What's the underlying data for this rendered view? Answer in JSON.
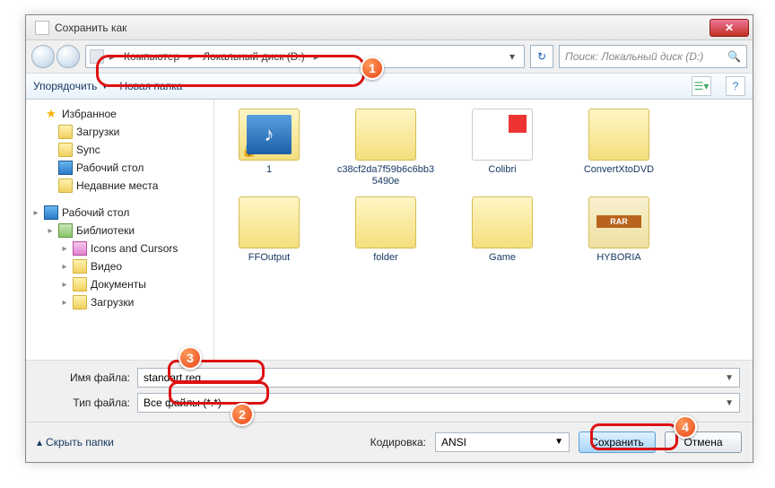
{
  "window": {
    "title": "Сохранить как"
  },
  "breadcrumb": {
    "seg1": "Компьютер",
    "seg2": "Локальный диск (D:)"
  },
  "search": {
    "placeholder": "Поиск: Локальный диск (D:)"
  },
  "toolbar": {
    "organize": "Упорядочить",
    "newfolder": "Новая папка"
  },
  "tree": {
    "favorites": "Избранное",
    "downloads": "Загрузки",
    "sync": "Sync",
    "desktop1": "Рабочий стол",
    "recent": "Недавние места",
    "desktop2": "Рабочий стол",
    "libraries": "Библиотеки",
    "icons": "Icons and Cursors",
    "video": "Видео",
    "documents": "Документы",
    "downloads2": "Загрузки"
  },
  "files": [
    {
      "name": "1",
      "kind": "music lock"
    },
    {
      "name": "c38cf2da7f59b6c6bb35490e",
      "kind": ""
    },
    {
      "name": "Colibri",
      "kind": "pdf"
    },
    {
      "name": "ConvertXtoDVD",
      "kind": ""
    },
    {
      "name": "FFOutput",
      "kind": ""
    },
    {
      "name": "folder",
      "kind": ""
    },
    {
      "name": "Game",
      "kind": ""
    },
    {
      "name": "HYBORIA",
      "kind": "rar"
    }
  ],
  "form": {
    "filename_label": "Имя файла:",
    "filename_value": "standart.reg",
    "filetype_label": "Тип файла:",
    "filetype_value": "Все файлы (*.*)"
  },
  "bottom": {
    "hide": "Скрыть папки",
    "encoding_label": "Кодировка:",
    "encoding_value": "ANSI",
    "save": "Сохранить",
    "cancel": "Отмена"
  },
  "annotations": {
    "n1": "1",
    "n2": "2",
    "n3": "3",
    "n4": "4"
  }
}
